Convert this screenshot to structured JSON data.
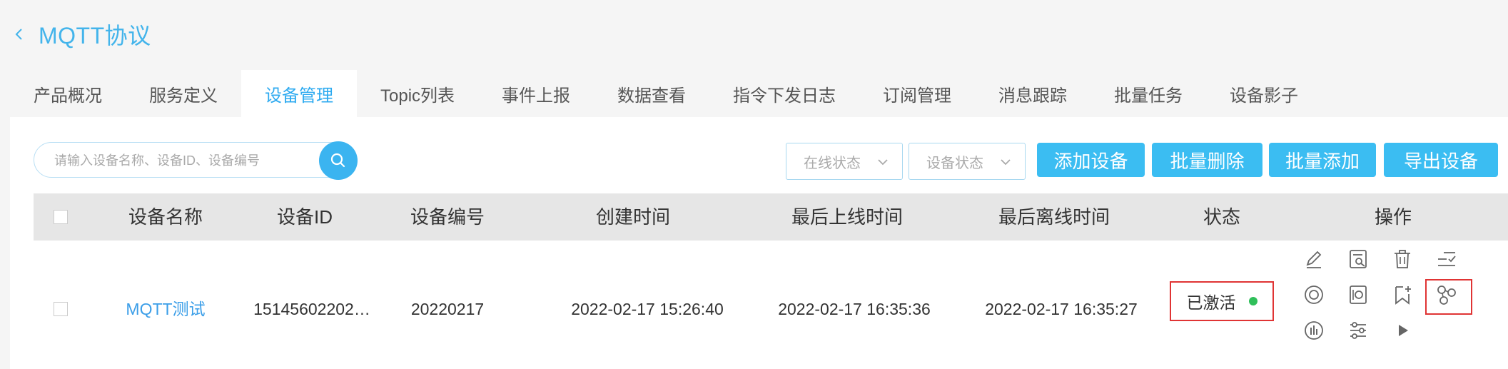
{
  "header": {
    "title": "MQTT协议"
  },
  "tabs": [
    {
      "label": "产品概况",
      "active": false
    },
    {
      "label": "服务定义",
      "active": false
    },
    {
      "label": "设备管理",
      "active": true
    },
    {
      "label": "Topic列表",
      "active": false
    },
    {
      "label": "事件上报",
      "active": false
    },
    {
      "label": "数据查看",
      "active": false
    },
    {
      "label": "指令下发日志",
      "active": false
    },
    {
      "label": "订阅管理",
      "active": false
    },
    {
      "label": "消息跟踪",
      "active": false
    },
    {
      "label": "批量任务",
      "active": false
    },
    {
      "label": "设备影子",
      "active": false
    }
  ],
  "toolbar": {
    "search_placeholder": "请输入设备名称、设备ID、设备编号",
    "online_status": "在线状态",
    "device_status": "设备状态",
    "add_device": "添加设备",
    "batch_delete": "批量删除",
    "batch_add": "批量添加",
    "export_device": "导出设备"
  },
  "table": {
    "headers": [
      "设备名称",
      "设备ID",
      "设备编号",
      "创建时间",
      "最后上线时间",
      "最后离线时间",
      "状态",
      "操作"
    ],
    "rows": [
      {
        "name": "MQTT测试",
        "id": "15145602202…",
        "number": "20220217",
        "created": "2022-02-17 15:26:40",
        "last_online": "2022-02-17 16:35:36",
        "last_offline": "2022-02-17 16:35:27",
        "status": "已激活",
        "status_color": "#2fbf5a"
      }
    ]
  },
  "operation_icons": [
    "edit-icon",
    "detail-search-icon",
    "delete-icon",
    "task-list-icon",
    "target-icon",
    "safe-icon",
    "bookmark-add-icon",
    "topology-icon",
    "chart-icon",
    "settings-sliders-icon",
    "play-icon"
  ],
  "colors": {
    "accent": "#3bbdf2",
    "title": "#43b4eb",
    "highlight": "#e03434"
  }
}
